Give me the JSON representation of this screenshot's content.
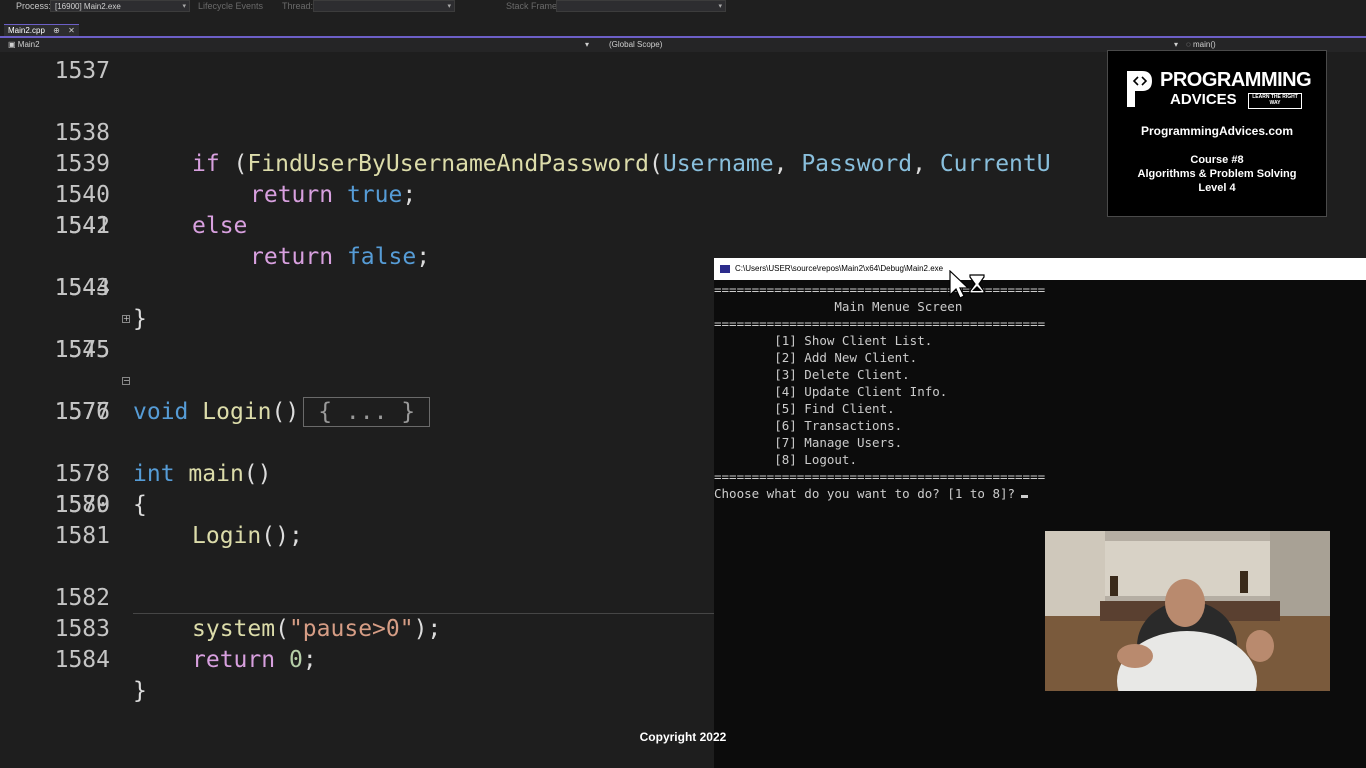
{
  "toolbar": {
    "process_label": "Process:",
    "process_value": "[16900] Main2.exe",
    "lifecycle_label": "Lifecycle Events",
    "thread_label": "Thread:",
    "stackframe_label": "Stack Frame:"
  },
  "tab": {
    "label": "Main2.cpp",
    "pin": "⊕",
    "close": "✕"
  },
  "navbar": {
    "project": "Main2",
    "scope": "(Global Scope)",
    "member": "main()"
  },
  "editor": {
    "line_numbers": [
      "1537",
      "1538",
      "1539",
      "1540",
      "1541",
      "1542",
      "1543",
      "1544",
      "1545",
      "1575",
      "1576",
      "1577",
      "1578",
      "1579",
      "1580",
      "1581",
      "1582",
      "1583",
      "1584"
    ],
    "l1538": {
      "kw": "if",
      "open": " (",
      "fn": "FindUserByUsernameAndPassword",
      "paren": "(",
      "a1": "Username",
      "c1": ", ",
      "a2": "Password",
      "c2": ", ",
      "a3": "CurrentU"
    },
    "l1539": {
      "kw": "return",
      "val": "true",
      "end": ";"
    },
    "l1540": {
      "kw": "else"
    },
    "l1541": {
      "kw": "return",
      "val": "false",
      "end": ";"
    },
    "l1543": {
      "brace": "}"
    },
    "l1545": {
      "type": "void",
      "fn": "Login",
      "parens": "()",
      "collapsed": "{ ... }"
    },
    "l1576": {
      "type": "int",
      "fn": "main",
      "parens": "()"
    },
    "l1578": {
      "brace": "{"
    },
    "l1579": {
      "fn": "Login",
      "rest": "();"
    },
    "l1582": {
      "fn": "system",
      "open": "(",
      "str": "\"pause>0\"",
      "close": ");"
    },
    "l1583": {
      "kw": "return",
      "num": "0",
      "end": ";"
    },
    "l1584": {
      "brace": "}"
    }
  },
  "console": {
    "title": "C:\\Users\\USER\\source\\repos\\Main2\\x64\\Debug\\Main2.exe",
    "lines": [
      "============================================",
      "                Main Menue Screen",
      "============================================",
      "        [1] Show Client List.",
      "        [2] Add New Client.",
      "        [3] Delete Client.",
      "        [4] Update Client Info.",
      "        [5] Find Client.",
      "        [6] Transactions.",
      "        [7] Manage Users.",
      "        [8] Logout.",
      "============================================",
      "Choose what do you want to do? [1 to 8]?"
    ]
  },
  "brand": {
    "logo_line1": "PROGRAMMING",
    "logo_line2": "ADVICES",
    "tagline": "LEARN THE RIGHT WAY",
    "website": "ProgrammingAdvices.com",
    "course_line1": "Course #8",
    "course_line2": "Algorithms & Problem Solving",
    "course_line3": "Level 4"
  },
  "footer": {
    "copyright": "Copyright 2022"
  }
}
